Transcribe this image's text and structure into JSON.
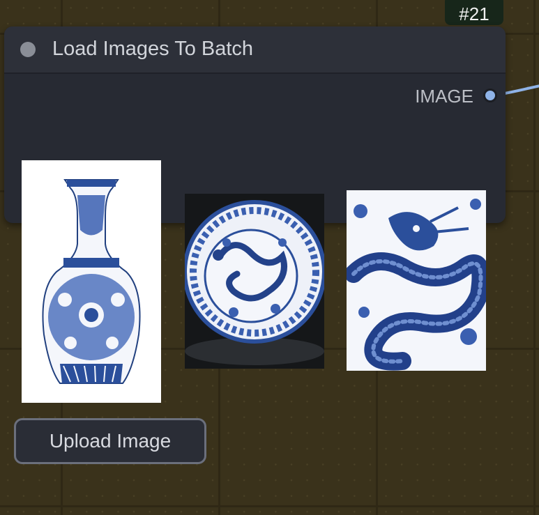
{
  "node": {
    "id_badge": "#21",
    "title": "Load Images To Batch",
    "output": {
      "label": "IMAGE"
    }
  },
  "images": [
    {
      "name": "vase"
    },
    {
      "name": "plate"
    },
    {
      "name": "dragon"
    }
  ],
  "upload_button": {
    "label": "Upload Image"
  },
  "colors": {
    "canvas": "#3a321b",
    "node_body": "#272a33",
    "node_header": "#2d3039",
    "slot": "#8fb3e8",
    "badge": "#17261a"
  }
}
